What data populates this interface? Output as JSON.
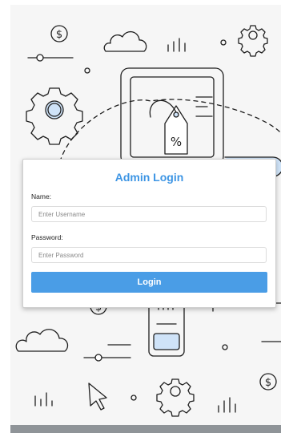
{
  "login": {
    "title": "Admin Login",
    "name_label": "Name:",
    "username_placeholder": "Enter Username",
    "password_label": "Password:",
    "password_placeholder": "Enter Password",
    "button_label": "Login"
  },
  "background": {
    "percent_symbol": "%",
    "dollar_symbol": "$",
    "icons": [
      "dollar-coin-icon",
      "cloud-icon",
      "bar-chart-icon",
      "gear-icon",
      "price-tag-icon",
      "mouse-cursor-icon",
      "smartphone-icon",
      "slider-icon"
    ]
  },
  "colors": {
    "accent": "#3d95e4",
    "button": "#4a9de6",
    "icon_stroke": "#1f1f1f",
    "icon_fill": "#cfe3f8"
  }
}
